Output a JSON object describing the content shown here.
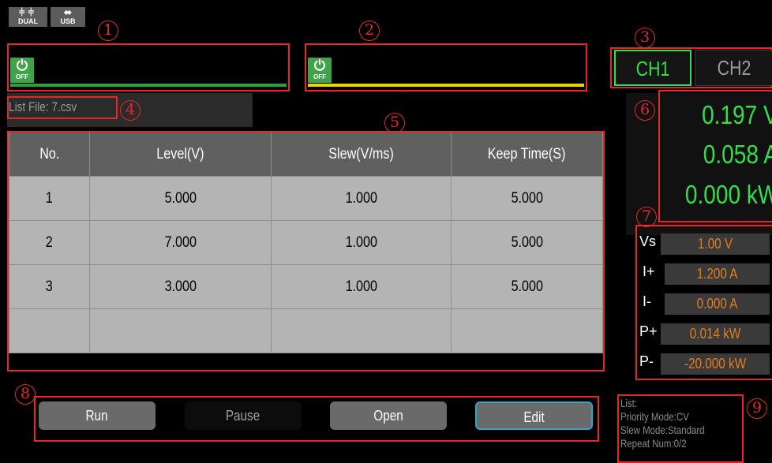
{
  "status_icons": {
    "dual_label": "DUAL",
    "usb_label": "USB",
    "dual_icon": "dual-channel-icon",
    "usb_icon": "usb-icon"
  },
  "markers": [
    "1",
    "2",
    "3",
    "4",
    "5",
    "6",
    "7",
    "8",
    "9"
  ],
  "channel1_panel": {
    "power_label": "OFF",
    "bar_color": "#2e9e3c"
  },
  "channel2_panel": {
    "power_label": "OFF",
    "bar_color": "#e8d400"
  },
  "channels": {
    "ch1": "CH1",
    "ch2": "CH2",
    "active_color": "#2fe04a"
  },
  "list_file": "List File: 7.csv",
  "table": {
    "headers": [
      "No.",
      "Level(V)",
      "Slew(V/ms)",
      "Keep Time(S)"
    ],
    "rows": [
      [
        "1",
        "5.000",
        "1.000",
        "5.000"
      ],
      [
        "2",
        "7.000",
        "1.000",
        "5.000"
      ],
      [
        "3",
        "3.000",
        "1.000",
        "5.000"
      ],
      [
        "",
        "",
        "",
        ""
      ]
    ]
  },
  "measurements": {
    "voltage": "0.197 V",
    "current": "0.058 A",
    "power": "0.000 kW"
  },
  "settings": [
    {
      "label": "Vs",
      "value": "1.00 V"
    },
    {
      "label": "I+",
      "value": "1.200 A"
    },
    {
      "label": "I-",
      "value": "0.000 A"
    },
    {
      "label": "P+",
      "value": "0.014 kW"
    },
    {
      "label": "P-",
      "value": "-20.000 kW"
    }
  ],
  "buttons": {
    "run": "Run",
    "pause": "Pause",
    "open": "Open",
    "edit": "Edit"
  },
  "info": {
    "list": "List:",
    "priority_mode": "Priority Mode:CV",
    "slew_mode": "Slew Mode:Standard",
    "repeat_num": "Repeat Num:0/2"
  }
}
